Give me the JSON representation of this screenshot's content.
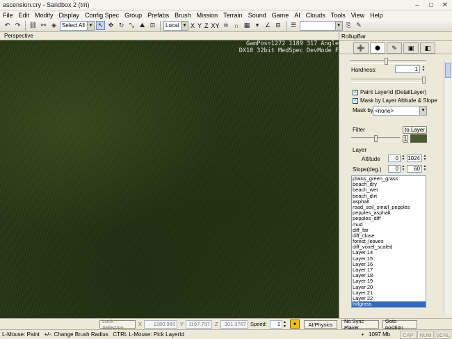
{
  "window": {
    "title": "ascension.cry - Sandbox 2 (tm)"
  },
  "menu": [
    "File",
    "Edit",
    "Modify",
    "Display",
    "Config Spec",
    "Group",
    "Prefabs",
    "Brush",
    "Mission",
    "Terrain",
    "Sound",
    "Game",
    "AI",
    "Clouds",
    "Tools",
    "View",
    "Help"
  ],
  "toolbar": {
    "select_label": "Select All",
    "coord_system": "Local",
    "axis_x": "X",
    "axis_y": "Y",
    "axis_z": "Z",
    "axis_xy": "XY"
  },
  "viewport": {
    "tab_label": "Perspective",
    "hud_line1": "GamPos=1272 1189 317 Angle",
    "hud_line2": "DX10 32bit MedSpec DevMode F"
  },
  "rollup": {
    "title": "RollupBar",
    "hardness_label": "Hardness:",
    "hardness_value": "1",
    "paint_layerid_label": "Paint LayerId (DetailLayer)",
    "mask_altitude_label": "Mask by Layer Altitude & Slope",
    "mask_by_label": "Mask by",
    "mask_by_value": "<none>",
    "filter_label": "Filter",
    "to_layer_button": "to Layer",
    "filter_small_button": "1",
    "layer_group_label": "Layer",
    "altitude_label": "Altitude",
    "altitude_min": "0",
    "altitude_max": "1024",
    "slope_label": "Slope(deg.)",
    "slope_min": "0",
    "slope_max": "60",
    "filter_color": "#4b5a2a",
    "layers": [
      "plains_green_grass",
      "beach_dry",
      "beach_wet",
      "beach_dirt",
      "asphalt",
      "road_soil_small_pepples",
      "pepples_asphalt",
      "pepples_diff",
      "mud",
      "diff_far",
      "diff_close",
      "forest_leaves",
      "diff_voxel_scaled",
      "Layer 14",
      "Layer 15",
      "Layer 16",
      "Layer 17",
      "Layer 18",
      "Layer 19",
      "Layer 20",
      "Layer 21",
      "Layer 22",
      "hillgrass"
    ],
    "selected_layer": "hillgrass"
  },
  "bottom": {
    "lock_selection": "Lock Selection",
    "x_label": "X",
    "x_value": "1280.965",
    "y_label": "Y",
    "y_value": "1197.797",
    "z_label": "Z",
    "z_value": "301.3767",
    "speed_label": "Speed:",
    "speed_value": "1",
    "ai_physics": "AI/Physics",
    "no_sync": "No Sync Player",
    "goto_position": "Goto position"
  },
  "status": {
    "hint": "L-Mouse: Paint   +/-: Change Brush Radius   CTRL L-Mouse: Pick LayerId",
    "memory": "1097 Mb",
    "cap": "CAP",
    "num": "NUM",
    "scrl": "SCRL"
  }
}
